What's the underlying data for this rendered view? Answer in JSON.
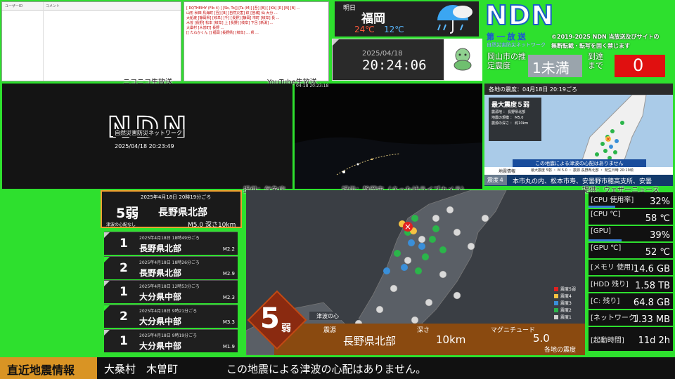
{
  "niconico": {
    "col_user": "ユーザーID",
    "col_comment": "コメント",
    "caption": "ニコニコ生放送"
  },
  "youtube": {
    "comments": "[ RQTHEIHY (Flb 4) ] [Sb, To]] [Ta (M)] [吾] [B] [ [KA] [R] [B] [B] ...  \n山形 秋田 鳥海町 [吾] [B] [自然災害] 紋 [宮城] 仙 大分 ...\n大船渡 [静岡県] [岐阜] [千] [長野] [静岡] 市町 [岐阜] 長 ...\n木曽 [長野] 松本 [岐阜] 上 [長野] [岐阜] 下呂 [新潟] ...\n大桑村 [木曽町] 長野 ...\n[[ たわかくん ]] 福岡 [長野県] [岐阜] ... 県 ...",
    "caption": "YouTube生放送"
  },
  "weather": {
    "day": "明日",
    "city": "福岡",
    "high": "24℃",
    "low": "12℃",
    "icon": "umbrella-rain-icon"
  },
  "clock": {
    "date": "2025/04/18",
    "time": "20:24:06"
  },
  "brand": {
    "logo": "NDN",
    "subtitle": "第 一 放 送",
    "tagline": "自然災害防災ネットワーク",
    "copyright_l1": "©2019-2025 NDN 当放送及びサイトの",
    "copyright_l2": "無断転載・転写を固く禁じます"
  },
  "okayama": {
    "label": "岡山市の推定震度",
    "intensity": "1未満",
    "arrival_label": "到達まで",
    "arrival": "0"
  },
  "main_stream": {
    "logo": "NDN",
    "tag": "自然災害防災ネットワーク",
    "timestamp": "2025/04/18 20:23:49"
  },
  "live_camera": {
    "timestamp": "04-18 20:23:18",
    "caption": "提供：静岡市（さった峠ライブカメラ）"
  },
  "weathernews": {
    "caption": "提供：ウェザーニュース",
    "header": "各地の震度：04月18日 20:19ごろ",
    "max_label": "最大震度５弱",
    "details": "震源地 ： 長野県北部\n地震の規模 ： M5.0\n震源の深さ ： 約10km",
    "tsunami": "この地震による津波の心配はありません",
    "info_label": "地震情報",
    "info_detail": "最大震度 5弱 ・ M 5.0 ・ 震源 長野県北部 ・ 発生日時 20:19頃",
    "ticker_level": "震度４",
    "ticker": "本市丸の内、松本市寿、安曇野市穂高支所、安曇"
  },
  "jma": {
    "caption": "提供：気象庁"
  },
  "latest": {
    "date": "2025年4月18日 20時19分ごろ",
    "scale": "5弱",
    "place": "長野県北部",
    "tsunami": "津波の心配なし",
    "mag": "M5.0 深さ10km"
  },
  "quakes": [
    {
      "time": "2025年4月18日 18時49分ごろ",
      "scale": "1",
      "place": "長野県北部",
      "mag": "M2.2",
      "tri": "grey"
    },
    {
      "time": "2025年4月18日 18時26分ごろ",
      "scale": "2",
      "place": "長野県北部",
      "mag": "M2.9",
      "tri": "green"
    },
    {
      "time": "2025年4月18日 12時53分ごろ",
      "scale": "1",
      "place": "大分県中部",
      "mag": "M2.3",
      "tri": "grey"
    },
    {
      "time": "2025年4月18日 9時21分ごろ",
      "scale": "2",
      "place": "大分県中部",
      "mag": "M3.3",
      "tri": "green"
    },
    {
      "time": "2025年4月18日 9時19分ごろ",
      "scale": "1",
      "place": "大分県中部",
      "mag": "M1.9",
      "tri": "grey"
    }
  ],
  "map_overlay": {
    "scale_digit": "5",
    "scale_suffix": "弱",
    "epicenter_label": "震源",
    "epicenter": "長野県北部",
    "depth_label": "深さ",
    "depth": "10km",
    "mag_label": "マグニチュード",
    "mag": "5.0",
    "area_label": "各地の震度",
    "tsunami_short": "津波の心",
    "legend": [
      "震度5弱",
      "震度4",
      "震度3",
      "震度2",
      "震度1"
    ],
    "legend_colors": [
      "#e02020",
      "#f5c242",
      "#3a8fd9",
      "#2bb54a",
      "#d0d0d0"
    ]
  },
  "stats": [
    {
      "key": "[CPU 使用率]",
      "value": "32%",
      "bar": 0.32
    },
    {
      "key": "[CPU ℃]",
      "value": "58 ℃",
      "bar": 0
    },
    {
      "key": "[GPU]",
      "value": "39%",
      "bar": 0.39
    },
    {
      "key": "[GPU ℃]",
      "value": "52 ℃",
      "bar": 0
    },
    {
      "key": "[メモリ 使用]",
      "value": "14.6 GB",
      "bar": 0
    },
    {
      "key": "[HDD 残り]",
      "value": "1.58 TB",
      "bar": 0
    },
    {
      "key": "[C: 残り]",
      "value": "64.8 GB",
      "bar": 0
    },
    {
      "key": "[ネットワーク]",
      "value": "1.33 MB",
      "bar": 0
    },
    {
      "key": "[起動時間]",
      "value": "11d 2h",
      "bar": 0
    }
  ],
  "footer": {
    "title": "直近地震情報",
    "places": "大桑村　木曽町",
    "message": "この地震による津波の心配はありません。"
  }
}
